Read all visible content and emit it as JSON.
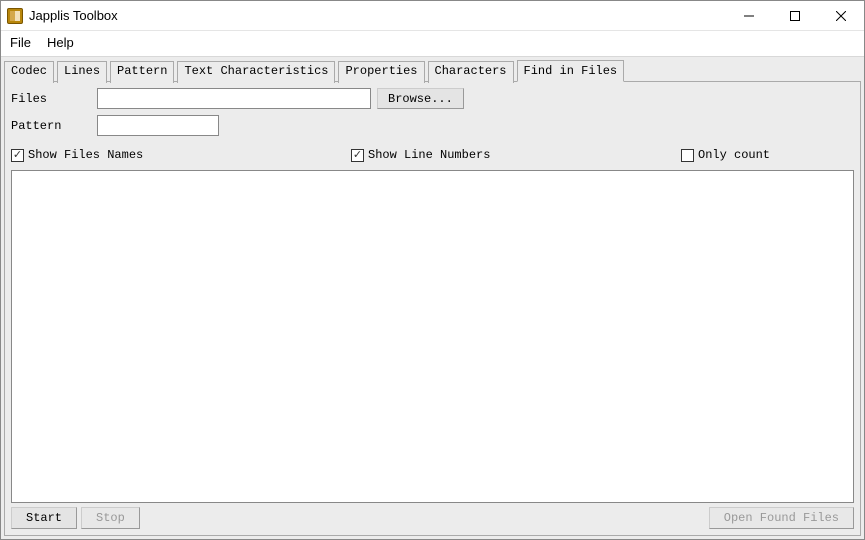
{
  "window": {
    "title": "Japplis Toolbox"
  },
  "menubar": {
    "file": "File",
    "help": "Help"
  },
  "tabs": [
    {
      "label": "Codec",
      "active": false
    },
    {
      "label": "Lines",
      "active": false
    },
    {
      "label": "Pattern",
      "active": false
    },
    {
      "label": "Text Characteristics",
      "active": false
    },
    {
      "label": "Properties",
      "active": false
    },
    {
      "label": "Characters",
      "active": false
    },
    {
      "label": "Find in Files",
      "active": true
    }
  ],
  "form": {
    "files_label": "Files",
    "files_value": "",
    "browse_label": "Browse...",
    "pattern_label": "Pattern",
    "pattern_value": ""
  },
  "checks": {
    "show_files_names": {
      "label": "Show Files Names",
      "checked": true
    },
    "show_line_numbers": {
      "label": "Show Line Numbers",
      "checked": true
    },
    "only_count": {
      "label": "Only count",
      "checked": false
    }
  },
  "results_text": "",
  "footer": {
    "start_label": "Start",
    "stop_label": "Stop",
    "open_found_label": "Open Found Files"
  }
}
